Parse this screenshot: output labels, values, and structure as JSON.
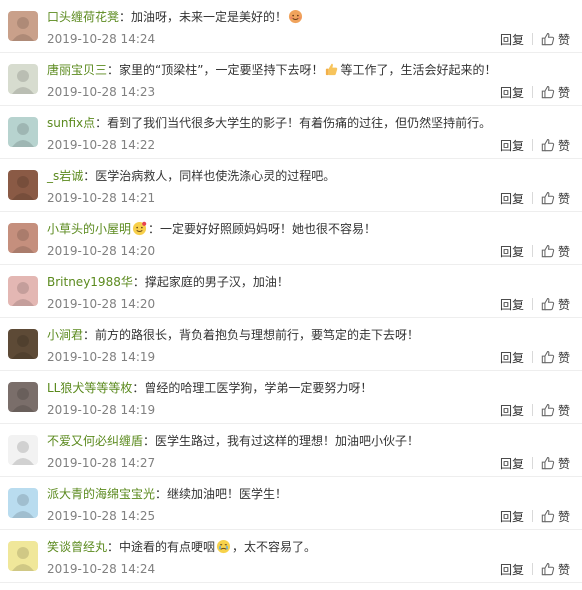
{
  "actions": {
    "reply_label": "回复",
    "like_label": "赞"
  },
  "comments": [
    {
      "user": "口头缠荷花凳",
      "text": "：加油呀，未来一定是美好的！",
      "time": "2019-10-28 14:24",
      "avatar_color": "#c9a08a",
      "emoji": "smile-emoji",
      "emoji_pos": "end"
    },
    {
      "user": "唐丽宝贝三",
      "text": "：家里的“顶梁柱”，一定要坚持下去呀！",
      "text2": "等工作了，生活会好起来的！",
      "time": "2019-10-28 14:23",
      "avatar_color": "#d7dccf",
      "emoji": "thumbs-up-emoji",
      "emoji_pos": "mid"
    },
    {
      "user": "sunfix点",
      "text": "：看到了我们当代很多大学生的影子！有着伤痛的过往，但仍然坚持前行。",
      "time": "2019-10-28 14:22",
      "avatar_color": "#b7d3cf"
    },
    {
      "user": "_s岩诚",
      "text": "：医学治病救人，同样也使洗涤心灵的过程吧。",
      "time": "2019-10-28 14:21",
      "avatar_color": "#8a5a45"
    },
    {
      "user": "小草头的小屋明",
      "text": "：一定要好好照顾妈妈呀！她也很不容易！",
      "time": "2019-10-28 14:20",
      "avatar_color": "#c58f7d",
      "emoji": "flower-emoji",
      "emoji_pos": "after-user"
    },
    {
      "user": "Britney1988华",
      "text": "：撑起家庭的男子汉，加油！",
      "time": "2019-10-28 14:20",
      "avatar_color": "#e3b7b3"
    },
    {
      "user": "小涧君",
      "text": "：前方的路很长，背负着抱负与理想前行，要笃定的走下去呀！",
      "time": "2019-10-28 14:19",
      "avatar_color": "#5d4a36"
    },
    {
      "user": "LL狼犬等等等枚",
      "text": "：曾经的哈理工医学狗，学弟一定要努力呀！",
      "time": "2019-10-28 14:19",
      "avatar_color": "#7a6e6a"
    },
    {
      "user": "不爱又何必纠缠盾",
      "text": "：医学生路过，我有过这样的理想！加油吧小伙子！",
      "time": "2019-10-28 14:27",
      "avatar_color": "#f2f2f2"
    },
    {
      "user": "派大青的海绵宝宝光",
      "text": "：继续加油吧！医学生！",
      "time": "2019-10-28 14:25",
      "avatar_color": "#b9dcef"
    },
    {
      "user": "笑谈曾经丸",
      "text": "：中途看的有点哽咽",
      "text2": "，太不容易了。",
      "time": "2019-10-28 14:24",
      "avatar_color": "#f0e79a",
      "emoji": "crying-emoji",
      "emoji_pos": "mid"
    }
  ]
}
